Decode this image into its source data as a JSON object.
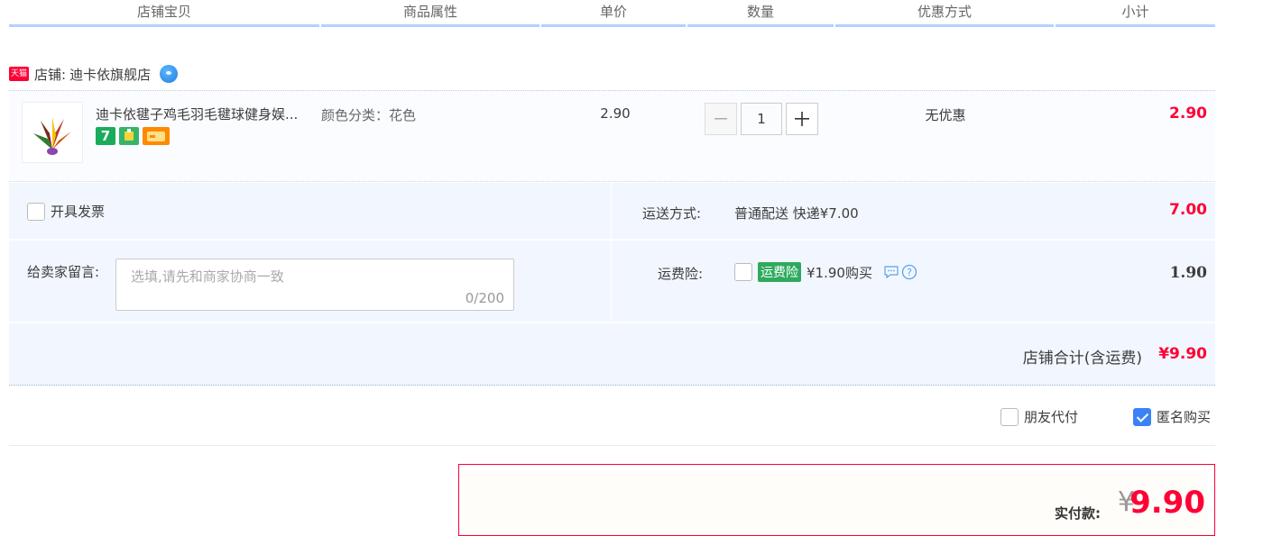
{
  "header": {
    "columns": [
      "店铺宝贝",
      "商品属性",
      "单价",
      "数量",
      "优惠方式",
      "小计"
    ]
  },
  "shop": {
    "badge": "天猫",
    "label": "店铺:",
    "name": "迪卡依旗舰店"
  },
  "item": {
    "title": "迪卡依毽子鸡毛羽毛毽球健身娱...",
    "badges": [
      "7",
      "warranty-icon",
      "card-icon"
    ],
    "badge_colors": [
      "#1aac5b",
      "#35b56a",
      "#ff8a00"
    ],
    "property": "颜色分类：花色",
    "price": "2.90",
    "quantity": "1",
    "promotion": "无优惠",
    "subtotal": "2.90"
  },
  "options": {
    "invoice_label": "开具发票",
    "shipping_label": "运送方式:",
    "shipping_value": "普通配送 快递¥7.00",
    "shipping_amount": "7.00",
    "message_label": "给卖家留言:",
    "message_placeholder": "选填,请先和商家协商一致",
    "message_count": "0/200",
    "insurance_label": "运费险:",
    "insurance_tag": "运费险",
    "insurance_text": "¥1.90购买",
    "insurance_amount": "1.90"
  },
  "shop_total": {
    "label": "店铺合计(含运费)",
    "amount": "¥9.90"
  },
  "pay_options": {
    "friend_pay": "朋友代付",
    "anonymous": "匿名购买"
  },
  "payment": {
    "label": "实付款:",
    "currency": "¥",
    "amount": "9.90"
  },
  "colors": {
    "accent_red": "#ff0036",
    "header_line": "#b2d1ff",
    "panel_bg": "#f2f7ff",
    "checkbox_checked": "#3b82f6"
  }
}
